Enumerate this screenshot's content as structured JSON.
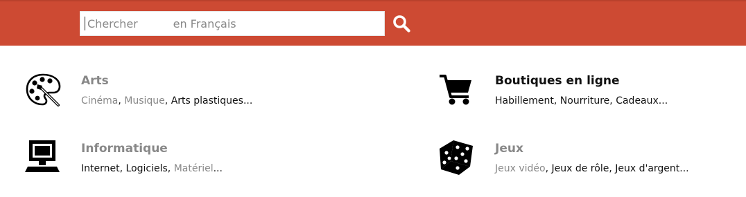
{
  "search": {
    "placeholder": "Chercher          en Français",
    "button_icon": "search-icon"
  },
  "colors": {
    "topbar": "#cd4a33",
    "muted_link": "#888888",
    "text": "#111111"
  },
  "categories": [
    {
      "title": "Arts",
      "icon": "palette-icon",
      "links": [
        {
          "label": "Cinéma",
          "sep": ", "
        },
        {
          "label": "Musique",
          "sep": ", "
        },
        {
          "label": "Arts plastiques",
          "sep": "..."
        }
      ]
    },
    {
      "title": "Boutiques en ligne",
      "icon": "shopping-cart-icon",
      "links": [
        {
          "label": "Habillement",
          "sep": ", "
        },
        {
          "label": "Nourriture",
          "sep": ", "
        },
        {
          "label": "Cadeaux",
          "sep": "..."
        }
      ]
    },
    {
      "title": "Informatique",
      "icon": "computer-icon",
      "links": [
        {
          "label": "Internet",
          "sep": ", "
        },
        {
          "label": "Logiciels",
          "sep": ", "
        },
        {
          "label": "Matériel",
          "sep": "..."
        }
      ]
    },
    {
      "title": "Jeux",
      "icon": "dice-icon",
      "links": [
        {
          "label": "Jeux vidéo",
          "sep": ", "
        },
        {
          "label": "Jeux de rôle",
          "sep": ", "
        },
        {
          "label": "Jeux d'argent",
          "sep": "..."
        }
      ]
    }
  ]
}
